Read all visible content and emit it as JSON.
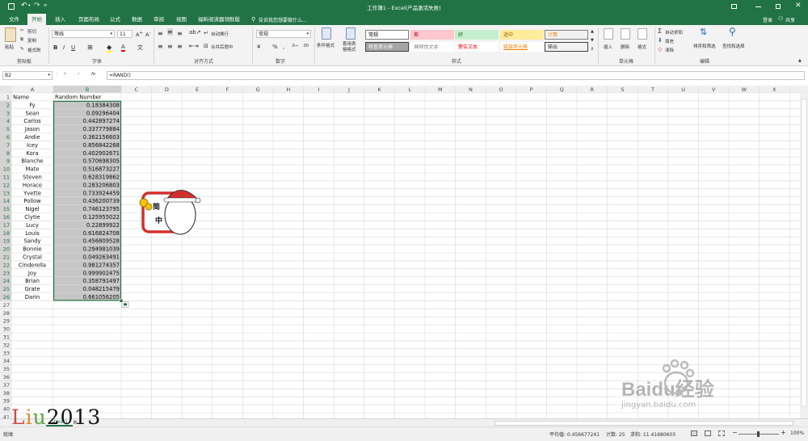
{
  "titlebar": {
    "title": "工作簿1 - Excel(产品激活失败)"
  },
  "tabs": [
    {
      "label": "文件",
      "active": false
    },
    {
      "label": "开始",
      "active": true
    },
    {
      "label": "插入",
      "active": false
    },
    {
      "label": "页面布局",
      "active": false
    },
    {
      "label": "公式",
      "active": false
    },
    {
      "label": "数据",
      "active": false
    },
    {
      "label": "审阅",
      "active": false
    },
    {
      "label": "视图",
      "active": false
    },
    {
      "label": "福昕阅读器领鲜版",
      "active": false
    }
  ],
  "tell_me": "告诉我您想要做什么...",
  "account": {
    "login": "登录",
    "share": "共享"
  },
  "ribbon": {
    "clipboard": {
      "paste": "粘贴",
      "cut": "剪切",
      "copy": "复制",
      "format_painter": "格式刷",
      "group": "剪贴板"
    },
    "font": {
      "name": "等线",
      "size": "11",
      "group": "字体"
    },
    "alignment": {
      "wrap": "自动换行",
      "merge": "合并后居中",
      "group": "对齐方式"
    },
    "number": {
      "format": "常规",
      "group": "数字"
    },
    "styles": {
      "conditional": "条件格式",
      "table": "套用表格格式",
      "group": "样式",
      "cells": [
        {
          "label": "常规",
          "bg": "#ffffff",
          "fg": "#000000",
          "border": "#7e7e7e"
        },
        {
          "label": "差",
          "bg": "#ffc7ce",
          "fg": "#9c0006",
          "border": "#ffc7ce"
        },
        {
          "label": "好",
          "bg": "#c6efce",
          "fg": "#006100",
          "border": "#c6efce"
        },
        {
          "label": "适中",
          "bg": "#ffeb9c",
          "fg": "#9c5700",
          "border": "#ffeb9c"
        },
        {
          "label": "计算",
          "bg": "#f2f2f2",
          "fg": "#fa7d00",
          "border": "#7f7f7f"
        },
        {
          "label": "检查单元格",
          "bg": "#a5a5a5",
          "fg": "#ffffff",
          "border": "#3f3f3f"
        },
        {
          "label": "解释性文本",
          "bg": "#ffffff",
          "fg": "#7f7f7f",
          "border": "#ffffff"
        },
        {
          "label": "警告文本",
          "bg": "#ffffff",
          "fg": "#ff0000",
          "border": "#ffffff"
        },
        {
          "label": "链接单元格",
          "bg": "#ffffff",
          "fg": "#fa7d00",
          "border": "#ffffff"
        },
        {
          "label": "输出",
          "bg": "#f2f2f2",
          "fg": "#3f3f3f",
          "border": "#3f3f3f"
        }
      ]
    },
    "cells": {
      "insert": "插入",
      "delete": "删除",
      "format": "格式",
      "group": "单元格"
    },
    "editing": {
      "autosum": "自动求和",
      "fill": "填充",
      "clear": "清除",
      "sort": "排序和筛选",
      "find": "查找和选择",
      "group": "编辑"
    }
  },
  "formula_bar": {
    "name_box": "B2",
    "fx": "fx",
    "formula": "=RAND()"
  },
  "columns": [
    "A",
    "B",
    "C",
    "D",
    "E",
    "F",
    "G",
    "H",
    "I",
    "J",
    "K",
    "L",
    "M",
    "N",
    "O",
    "P",
    "Q",
    "R",
    "S",
    "T",
    "U",
    "V",
    "W",
    "X"
  ],
  "header_row": {
    "a": "Name",
    "b": "Random Number"
  },
  "rows": [
    {
      "name": "Fy",
      "value": "0.18384308"
    },
    {
      "name": "Sean",
      "value": "0.09296404"
    },
    {
      "name": "Carlos",
      "value": "0.442897274"
    },
    {
      "name": "Jason",
      "value": "0.337779884"
    },
    {
      "name": "Andie",
      "value": "0.362156603"
    },
    {
      "name": "Icey",
      "value": "0.856842268"
    },
    {
      "name": "Kora",
      "value": "0.402902671"
    },
    {
      "name": "Blanche",
      "value": "0.570698305"
    },
    {
      "name": "Mate",
      "value": "0.516873227"
    },
    {
      "name": "Steven",
      "value": "0.628319862"
    },
    {
      "name": "Horace",
      "value": "0.283206803"
    },
    {
      "name": "Yvette",
      "value": "0.733924459"
    },
    {
      "name": "Pollow",
      "value": "0.436200739"
    },
    {
      "name": "Nigel",
      "value": "0.746123795"
    },
    {
      "name": "Clytie",
      "value": "0.125955022"
    },
    {
      "name": "Lucy",
      "value": "0.22899922"
    },
    {
      "name": "Louis",
      "value": "0.616824708"
    },
    {
      "name": "Sandy",
      "value": "0.456809528"
    },
    {
      "name": "Bonnie",
      "value": "0.294981039"
    },
    {
      "name": "Crystal",
      "value": "0.049263491"
    },
    {
      "name": "Cinderella",
      "value": "0.981274357"
    },
    {
      "name": "Joy",
      "value": "0.999902475"
    },
    {
      "name": "Brian",
      "value": "0.358791497"
    },
    {
      "name": "Grate",
      "value": "0.048215479"
    },
    {
      "name": "Darin",
      "value": "0.661056205"
    }
  ],
  "total_rows": 41,
  "sticker": {
    "text_top": "简",
    "text_bottom": "中"
  },
  "sheet_tab": "Sheet1",
  "watermark": {
    "author": "Liu2013",
    "site": "Baidu经验",
    "url": "jingyan.baidu.com"
  },
  "status": {
    "ready": "就绪",
    "average": "平均值: 0.456677241",
    "count": "计数: 25",
    "sum": "求和: 11.41680603",
    "zoom": "100%"
  },
  "colors": {
    "excel_green": "#217346",
    "selection": "#c6c6c6",
    "selection_border": "#217346"
  }
}
